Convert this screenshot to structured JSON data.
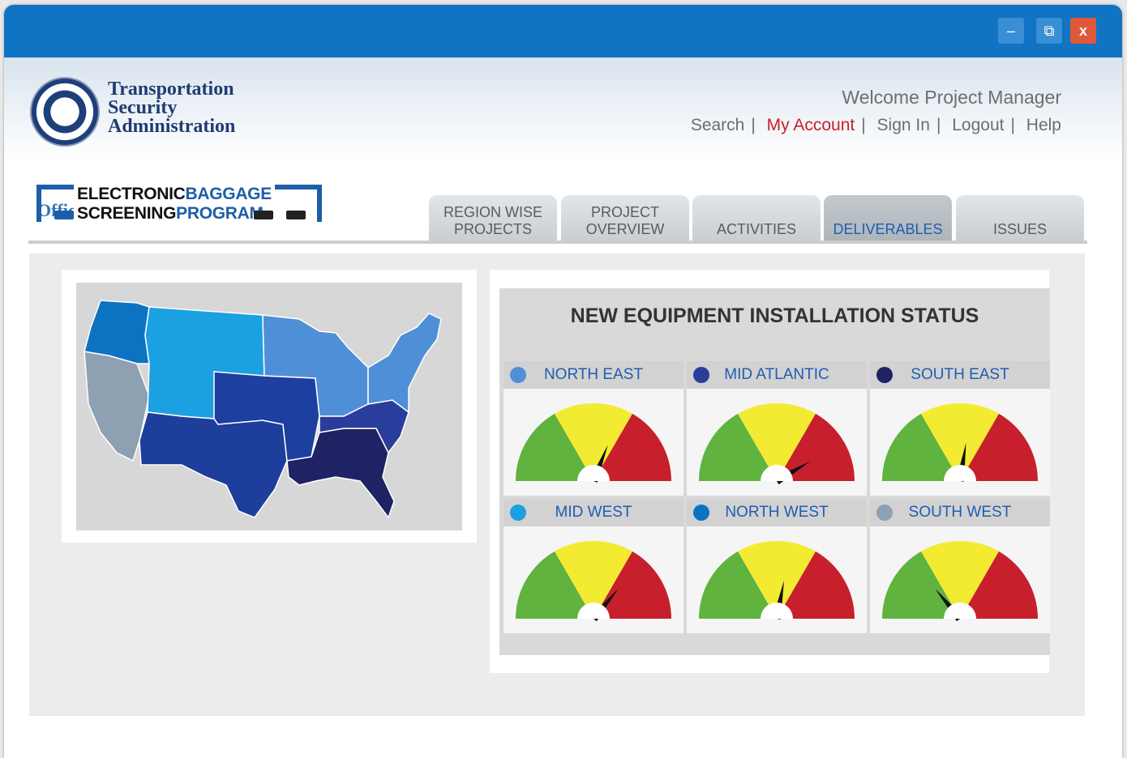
{
  "window": {
    "buttons": {
      "minimize": "–",
      "maximize": "⧉",
      "close": "x"
    }
  },
  "header": {
    "org_name": "Transportation Security Administration",
    "org_lines": [
      "Transportation",
      "Security",
      "Administration"
    ],
    "office": "Office of Security Technology",
    "program": {
      "line1_a": "ELECTRONIC",
      "line1_b": "BAGGAGE",
      "line2_a": "SCREENING",
      "line2_b": "PROGRAM"
    },
    "welcome": "Welcome Project Manager",
    "links": [
      "Search",
      "My Account",
      "Sign In",
      "Logout",
      "Help"
    ],
    "separator": "|"
  },
  "tabs": [
    {
      "label": "REGION WISE PROJECTS",
      "line1": "REGION WISE",
      "line2": "PROJECTS",
      "active": false
    },
    {
      "label": "PROJECT OVERVIEW",
      "line1": "PROJECT",
      "line2": "OVERVIEW",
      "active": false
    },
    {
      "label": "ACTIVITIES",
      "line1": "",
      "line2": "ACTIVITIES",
      "active": false
    },
    {
      "label": "DELIVERABLES",
      "line1": "",
      "line2": "DELIVERABLES",
      "active": true
    },
    {
      "label": "ISSUES",
      "line1": "",
      "line2": "ISSUES",
      "active": false
    }
  ],
  "status": {
    "title": "NEW EQUIPMENT  INSTALLATION STATUS",
    "regions": [
      {
        "name": "NORTH EAST",
        "color": "#4f8fd8",
        "needle": 0.62
      },
      {
        "name": "MID ATLANTIC",
        "color": "#2b3d9c",
        "needle": 0.83
      },
      {
        "name": "SOUTH EAST",
        "color": "#1f2363",
        "needle": 0.55
      },
      {
        "name": "MID WEST",
        "color": "#1ba1e2",
        "needle": 0.72
      },
      {
        "name": "NORTH WEST",
        "color": "#0c73c2",
        "needle": 0.56
      },
      {
        "name": "SOUTH WEST",
        "color": "#8ea1b3",
        "needle": 0.28
      }
    ],
    "gauge_colors": {
      "green": "#5fb33e",
      "yellow": "#f2eb32",
      "red": "#c81f2c"
    }
  },
  "map": {
    "colors": {
      "pacific": "#8ea1b3",
      "northwest": "#0c73c2",
      "mountain": "#1ba1e2",
      "southwest": "#1e3e9c",
      "midwest": "#4f8fd8",
      "central": "#1d3fa0",
      "southeast": "#1f2363",
      "atlantic": "#2b3d9c",
      "northeast": "#4f8fd8"
    }
  }
}
